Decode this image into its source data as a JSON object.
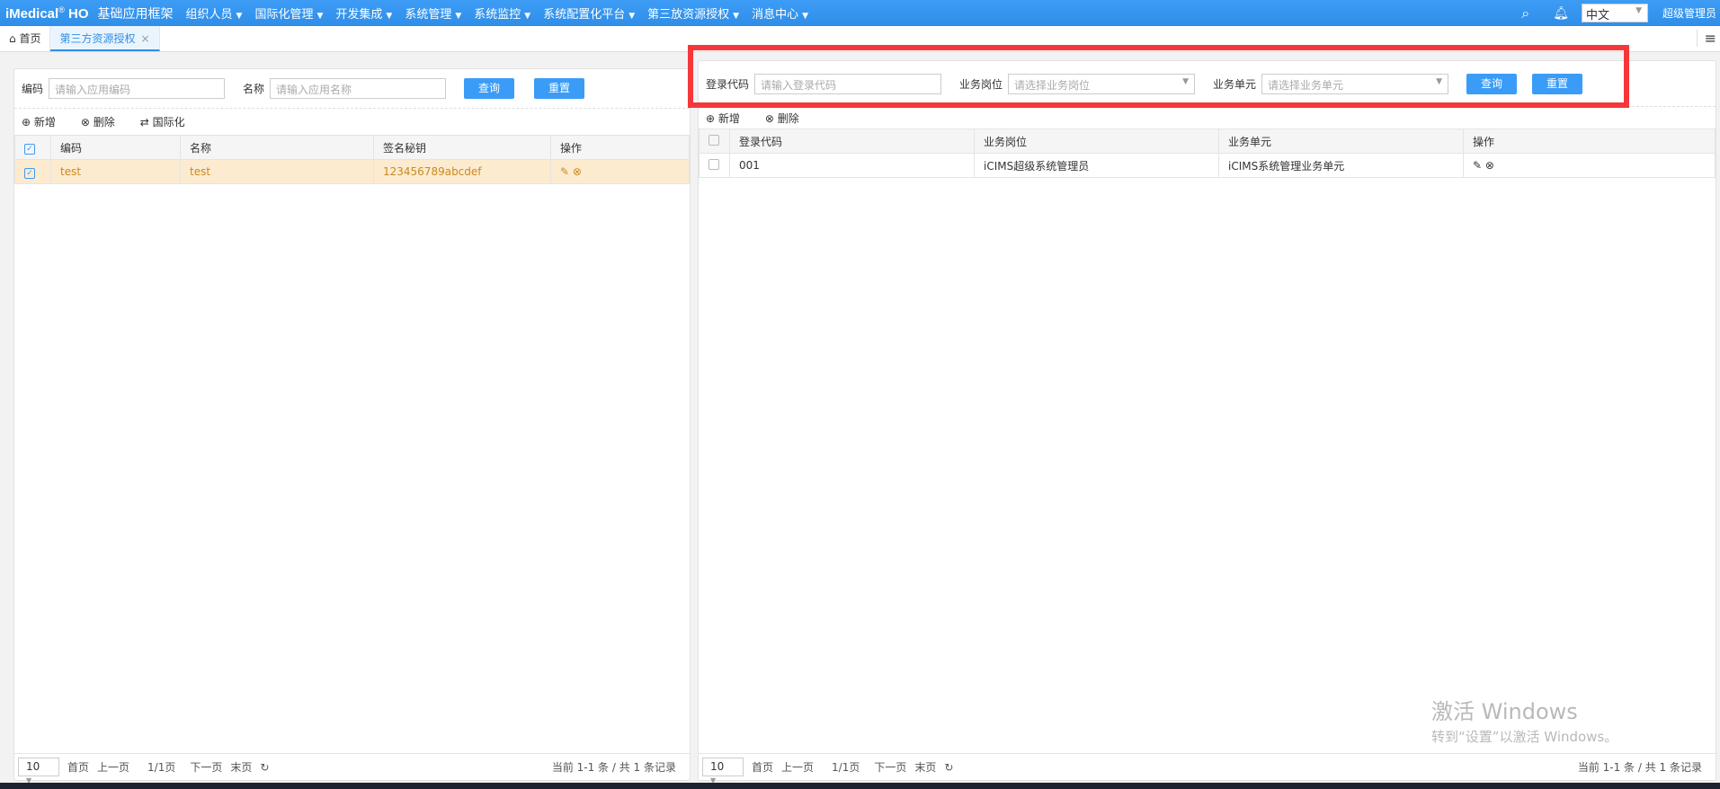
{
  "nav": {
    "logo": "iMedical",
    "logo_reg": "®",
    "logo_suffix": "HO",
    "first": "基础应用框架",
    "menus": [
      "组织人员",
      "国际化管理",
      "开发集成",
      "系统管理",
      "系统监控",
      "系统配置化平台",
      "第三放资源授权",
      "消息中心"
    ],
    "lang": "中文",
    "user": "超级管理员"
  },
  "tabs": {
    "home": "首页",
    "active": "第三方资源授权"
  },
  "left": {
    "code_label": "编码",
    "code_ph": "请输入应用编码",
    "name_label": "名称",
    "name_ph": "请输入应用名称",
    "query": "查询",
    "reset": "重置",
    "add": "新增",
    "delete": "删除",
    "i18n": "国际化",
    "columns": [
      "编码",
      "名称",
      "签名秘钥",
      "操作"
    ],
    "rows": [
      {
        "code": "test",
        "name": "test",
        "secret": "123456789abcdef"
      }
    ],
    "pager": {
      "size": "10",
      "first": "首页",
      "prev": "上一页",
      "page": "1/1页",
      "next": "下一页",
      "last": "末页",
      "total": "当前 1-1 条 / 共 1 条记录"
    }
  },
  "right": {
    "login_label": "登录代码",
    "login_ph": "请输入登录代码",
    "post_label": "业务岗位",
    "post_ph": "请选择业务岗位",
    "unit_label": "业务单元",
    "unit_ph": "请选择业务单元",
    "query": "查询",
    "reset": "重置",
    "add": "新增",
    "delete": "删除",
    "columns": [
      "登录代码",
      "业务岗位",
      "业务单元",
      "操作"
    ],
    "rows": [
      {
        "login": "001",
        "post": "iCIMS超级系统管理员",
        "unit": "iCIMS系统管理业务单元"
      }
    ],
    "pager": {
      "size": "10",
      "first": "首页",
      "prev": "上一页",
      "page": "1/1页",
      "next": "下一页",
      "last": "末页",
      "total": "当前 1-1 条 / 共 1 条记录"
    }
  },
  "watermark": {
    "title": "激活 Windows",
    "sub": "转到“设置”以激活 Windows。"
  }
}
